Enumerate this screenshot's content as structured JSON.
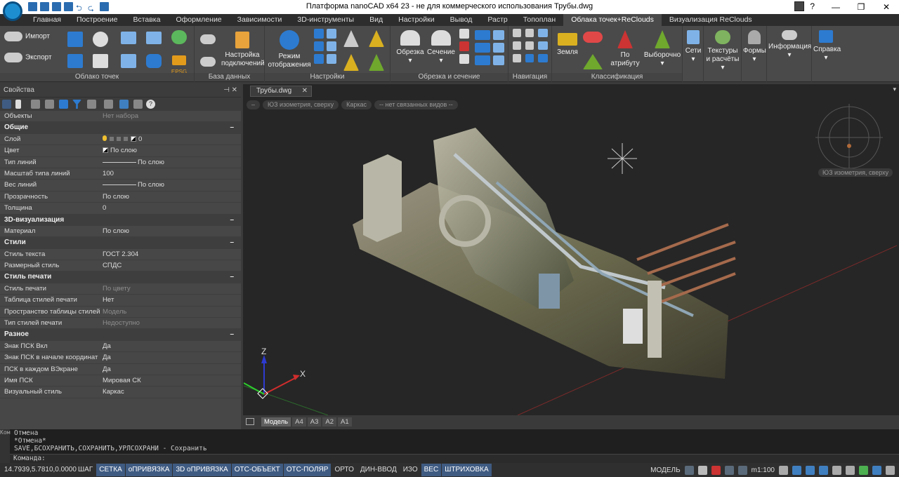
{
  "window": {
    "title": "Платформа nanoCAD x64 23 - не для коммерческого использования Трубы.dwg",
    "help_label": "?"
  },
  "ribbon_tabs": [
    "Главная",
    "Построение",
    "Вставка",
    "Оформление",
    "Зависимости",
    "3D-инструменты",
    "Вид",
    "Настройки",
    "Вывод",
    "Растр",
    "Топоплан",
    "Облака точек+ReClouds",
    "Визуализация ReClouds"
  ],
  "ribbon_active_tab": "Облака точек+ReClouds",
  "ribbon": {
    "groups": {
      "point_cloud": "Облако точек",
      "database": "База данных",
      "settings": "Настройки",
      "clip": "Обрезка и сечение",
      "navigation": "Навигация",
      "classification": "Классификация"
    },
    "buttons": {
      "import": "Импорт",
      "export": "Экспорт",
      "epsg": "EPSG",
      "conn_settings": "Настройка подключений",
      "display_mode": "Режим отображения",
      "clip": "Обрезка",
      "section": "Сечение",
      "ground": "Земля",
      "by_attribute": "По атрибуту",
      "selective": "Выборочно",
      "networks": "Сети",
      "textures": "Текстуры и расчёты",
      "forms": "Формы",
      "info": "Информация",
      "help": "Справка"
    }
  },
  "properties": {
    "title": "Свойства",
    "top_rows": [
      {
        "k": "Объекты",
        "v": "Нет набора",
        "dim": true
      }
    ],
    "sections": [
      {
        "name": "Общие",
        "rows": [
          {
            "k": "Слой",
            "v": "0",
            "type": "layer"
          },
          {
            "k": "Цвет",
            "v": "По слою",
            "type": "color"
          },
          {
            "k": "Тип линий",
            "v": "По слою",
            "type": "line"
          },
          {
            "k": "Масштаб типа линий",
            "v": "100"
          },
          {
            "k": "Вес линий",
            "v": "По слою",
            "type": "line"
          },
          {
            "k": "Прозрачность",
            "v": "По слою"
          },
          {
            "k": "Толщина",
            "v": "0"
          }
        ]
      },
      {
        "name": "3D-визуализация",
        "rows": [
          {
            "k": "Материал",
            "v": "По слою"
          }
        ]
      },
      {
        "name": "Стили",
        "rows": [
          {
            "k": "Стиль текста",
            "v": "ГОСТ 2.304"
          },
          {
            "k": "Размерный стиль",
            "v": "СПДС"
          }
        ]
      },
      {
        "name": "Стиль печати",
        "rows": [
          {
            "k": "Стиль печати",
            "v": "По цвету",
            "dim": true
          },
          {
            "k": "Таблица стилей печати",
            "v": "Нет"
          },
          {
            "k": "Пространство таблицы стилей п...",
            "v": "Модель",
            "dim": true
          },
          {
            "k": "Тип стилей печати",
            "v": "Недоступно",
            "dim": true
          }
        ]
      },
      {
        "name": "Разное",
        "rows": [
          {
            "k": "Знак ПСК Вкл",
            "v": "Да"
          },
          {
            "k": "Знак ПСК в начале координат",
            "v": "Да"
          },
          {
            "k": "ПСК в каждом ВЭкране",
            "v": "Да"
          },
          {
            "k": "Имя ПСК",
            "v": "Мировая СК"
          },
          {
            "k": "Визуальный стиль",
            "v": "Каркас"
          }
        ]
      }
    ],
    "collapse_glyph": "–"
  },
  "viewport": {
    "doc_tab": "Трубы.dwg",
    "view_controls": [
      "–",
      "ЮЗ изометрия, сверху",
      "Каркас",
      "-- нет связанных видов --"
    ],
    "compass_label": "ЮЗ изометрия, сверху",
    "axis_x": "X",
    "axis_z": "Z",
    "layout_tabs": [
      "Модель",
      "A4",
      "A3",
      "A2",
      "A1"
    ],
    "active_layout": "Модель"
  },
  "command": {
    "side_label": "Ком",
    "lines": [
      "Отмена",
      "*Отмена*",
      "SAVE,БСОХРАНИТЬ,СОХРАНИТЬ,УРЛСОХРАНИ - Сохранить"
    ],
    "prompt": "Команда:"
  },
  "status": {
    "coords": "14.7939,5.7810,0.0000",
    "toggles": [
      {
        "label": "ШАГ",
        "on": false
      },
      {
        "label": "СЕТКА",
        "on": true
      },
      {
        "label": "оПРИВЯЗКА",
        "on": true
      },
      {
        "label": "3D оПРИВЯЗКА",
        "on": true
      },
      {
        "label": "ОТС-ОБЪЕКТ",
        "on": true
      },
      {
        "label": "ОТС-ПОЛЯР",
        "on": true
      },
      {
        "label": "ОРТО",
        "on": false
      },
      {
        "label": "ДИН-ВВОД",
        "on": false
      },
      {
        "label": "ИЗО",
        "on": false
      },
      {
        "label": "ВЕС",
        "on": true
      },
      {
        "label": "ШТРИХОВКА",
        "on": true
      }
    ],
    "model": "МОДЕЛЬ",
    "scale": "m1:100"
  },
  "colors": {
    "accent": "#3f5b82",
    "bg_panel": "#474747",
    "bg_view": "#262626"
  }
}
